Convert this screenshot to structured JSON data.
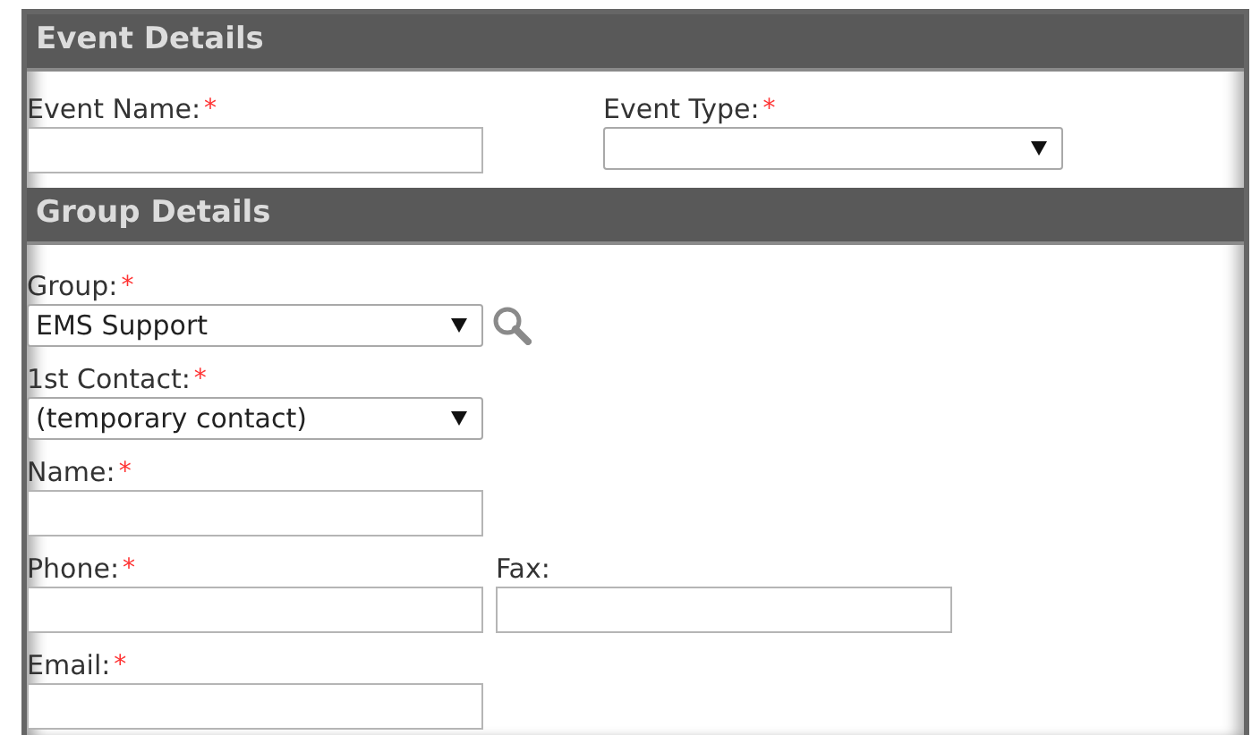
{
  "sections": [
    {
      "title": "Event Details",
      "rows": [
        [
          {
            "label": "Event Name:",
            "marker": "*",
            "kind": "text"
          },
          {
            "label": "Event Type:",
            "marker": "*",
            "kind": "select"
          }
        ]
      ]
    },
    {
      "title": "Group Details",
      "rows": [
        [
          {
            "label": "Group:",
            "marker": "*",
            "kind": "select",
            "value": "EMS Support",
            "search": true
          }
        ],
        [
          {
            "label": "1st Contact:",
            "marker": "*",
            "kind": "select",
            "value": "(temporary contact)"
          }
        ],
        [
          {
            "label": "Name:",
            "marker": "*",
            "kind": "text"
          }
        ],
        [
          {
            "label": "Phone:",
            "marker": "*",
            "kind": "text"
          },
          {
            "label": "Fax:",
            "kind": "text"
          }
        ],
        [
          {
            "label": "Email:",
            "marker": "*",
            "kind": "text"
          }
        ]
      ]
    }
  ]
}
